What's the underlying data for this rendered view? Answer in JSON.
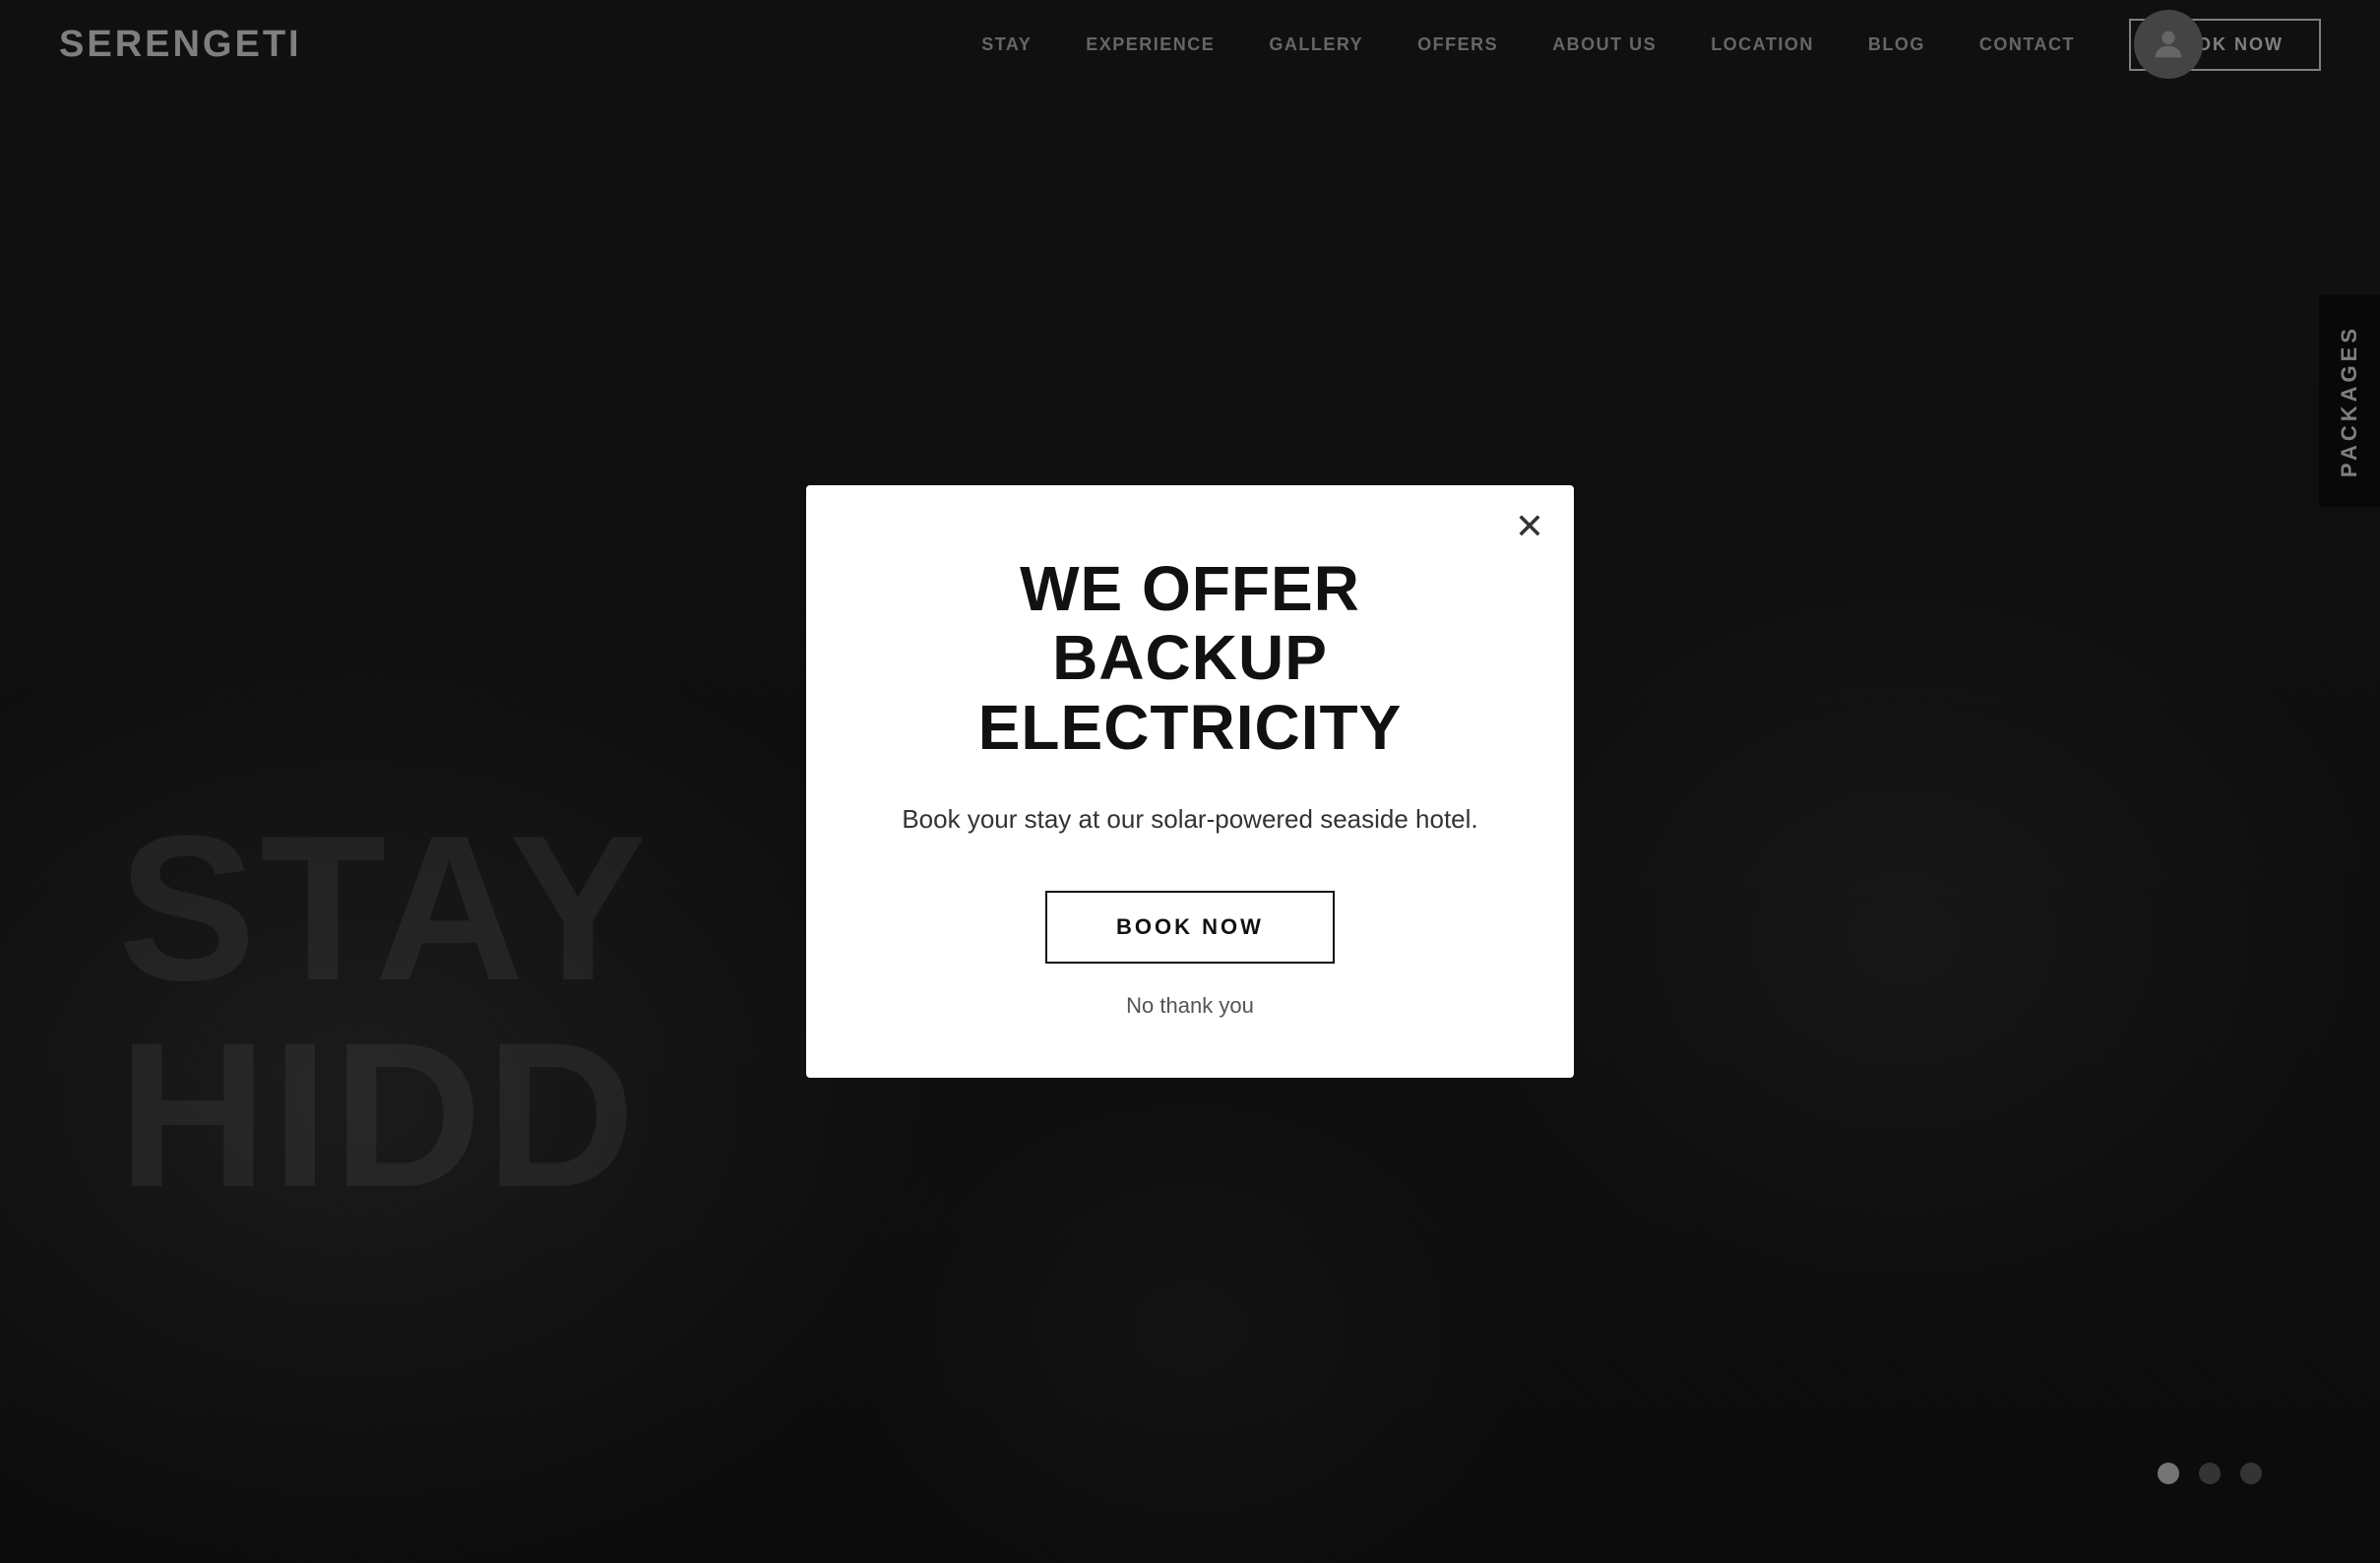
{
  "brand": {
    "logo": "SERENGETI"
  },
  "navbar": {
    "links": [
      {
        "label": "STAY",
        "id": "stay"
      },
      {
        "label": "EXPERIENCE",
        "id": "experience"
      },
      {
        "label": "GALLERY",
        "id": "gallery"
      },
      {
        "label": "OFFERS",
        "id": "offers"
      },
      {
        "label": "ABOUT US",
        "id": "about-us"
      },
      {
        "label": "LOCATION",
        "id": "location"
      },
      {
        "label": "BLOG",
        "id": "blog"
      },
      {
        "label": "CONTACT",
        "id": "contact"
      }
    ],
    "book_btn": "BOOK NOW"
  },
  "hero": {
    "line1": "STAY",
    "line2": "HIDD"
  },
  "packages_tab": "PACKAGES",
  "modal": {
    "title_line1": "WE OFFER BACKUP",
    "title_line2": "ELECTRICITY",
    "subtitle": "Book your stay at our solar-powered seaside hotel.",
    "book_btn": "BOOK NOW",
    "no_thanks": "No thank you"
  },
  "slider": {
    "dots": [
      {
        "active": true
      },
      {
        "active": false
      },
      {
        "active": false
      }
    ]
  }
}
